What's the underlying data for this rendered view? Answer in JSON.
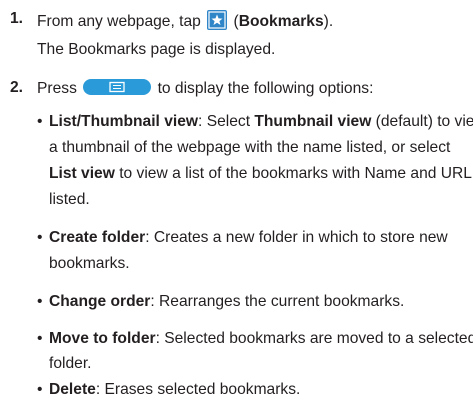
{
  "steps": [
    {
      "number": "1.",
      "text_a": "From any webpage, tap",
      "text_b": "(",
      "bold": "Bookmarks",
      "text_c": ").",
      "result": "The Bookmarks page is displayed."
    },
    {
      "number": "2.",
      "text_a": "Press",
      "text_b": "to display the following options:"
    }
  ],
  "options": [
    {
      "bullet": "•",
      "term": "List/Thumbnail view",
      "l1": ": Select ",
      "l1_bold": "Thumbnail view",
      "l1_end": " (default) to view",
      "l2": "a thumbnail of the webpage with the name listed, or select",
      "l3_bold": "List view",
      "l3": " to view a list of the bookmarks with Name and URL",
      "l4": "listed."
    },
    {
      "bullet": "•",
      "term": "Create folder",
      "l1": ": Creates a new folder in which to store new",
      "l2": "bookmarks."
    },
    {
      "bullet": "•",
      "term": "Change order",
      "l1": ": Rearranges the current bookmarks."
    },
    {
      "bullet": "•",
      "term": "Move to folder",
      "l1": ": Selected bookmarks are moved to a selected",
      "l2": "folder."
    },
    {
      "bullet": "•",
      "term": "Delete",
      "l1": ": Erases selected bookmarks."
    }
  ],
  "icons": {
    "bookmarks": "bookmark-star-icon",
    "menu_key": "menu-key-icon"
  },
  "colors": {
    "text": "#231f20",
    "bookmark_icon": "#2e86c9",
    "menu_key": "#2b9ad8"
  }
}
